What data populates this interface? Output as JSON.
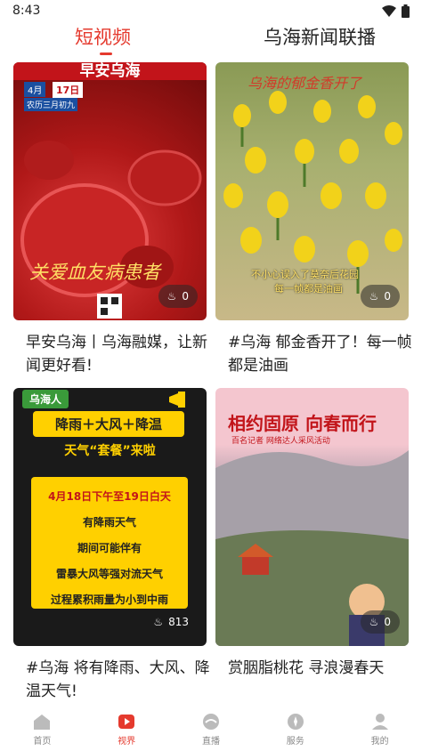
{
  "status": {
    "time": "8:43"
  },
  "tabs": {
    "active": "短视频",
    "inactive": "乌海新闻联播"
  },
  "cards": [
    {
      "thumb_title": "早安乌海",
      "thumb_date_month": "4月",
      "thumb_date_day": "17日",
      "thumb_lunar": "农历三月初九",
      "thumb_overlay": "关爱血友病患者",
      "likes": "0",
      "caption": "早安乌海丨乌海融媒，让新闻更好看!"
    },
    {
      "thumb_title": "乌海的郁金香开了",
      "thumb_overlay_line1": "不小心误入了莫奈后花园",
      "thumb_overlay_line2": "每一帧都是油画",
      "likes": "0",
      "caption": "#乌海 郁金香开了！每一帧都是油画"
    },
    {
      "thumb_brand": "乌海人",
      "thumb_headline": "降雨＋大风＋降温",
      "thumb_subhead": "天气“套餐”来啦",
      "thumb_lines": [
        "4月18日下午至19日白天",
        "有降雨天气",
        "期间可能伴有",
        "雷暴大风等强对流天气",
        "过程累积雨量为小到中雨"
      ],
      "likes": "813",
      "caption": "#乌海 将有降雨、大风、降温天气!"
    },
    {
      "thumb_title": "相约固原 向春而行",
      "thumb_sub": "百名记者 网络达人采风活动",
      "likes": "0",
      "caption": "赏胭脂桃花 寻浪漫春天"
    }
  ],
  "nav": [
    {
      "label": "首页",
      "icon": "home-icon"
    },
    {
      "label": "视界",
      "icon": "video-icon"
    },
    {
      "label": "直播",
      "icon": "live-icon"
    },
    {
      "label": "服务",
      "icon": "service-icon"
    },
    {
      "label": "我的",
      "icon": "profile-icon"
    }
  ],
  "colors": {
    "accent": "#e53a2e"
  }
}
